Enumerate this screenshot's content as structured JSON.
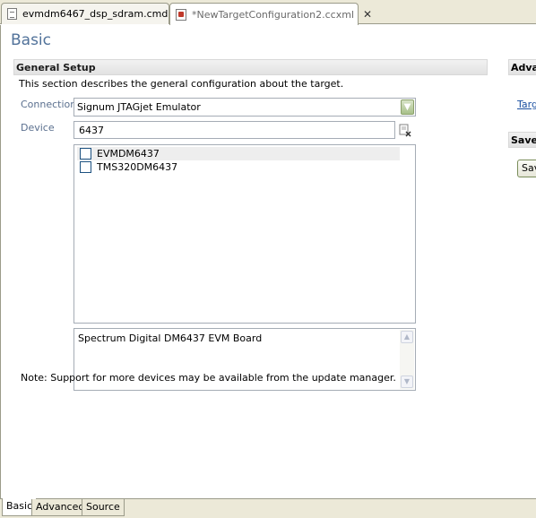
{
  "editor_tabs": [
    {
      "label": "evmdm6467_dsp_sdram.cmd",
      "icon": "file-icon",
      "active": false
    },
    {
      "label": "*NewTargetConfiguration2.ccxml",
      "icon": "target-config-icon",
      "active": true,
      "close": "close-icon"
    }
  ],
  "page_title": "Basic",
  "general_setup": {
    "title": "General Setup",
    "description": "This section describes the general configuration about the target.",
    "connection_label": "Connection",
    "connection_value": "Signum JTAGjet Emulator",
    "device_label": "Device",
    "device_filter": "6437",
    "devices": [
      {
        "label": "EVMDM6437",
        "checked": false,
        "selected": true
      },
      {
        "label": "TMS320DM6437",
        "checked": false,
        "selected": false
      }
    ],
    "device_description": "Spectrum Digital DM6437 EVM Board",
    "note": "Note: Support for more devices may be available from the update manager."
  },
  "advanced_section": {
    "title": "Adva",
    "link": "Targ"
  },
  "save_section": {
    "title": "Save",
    "button": "Sav"
  },
  "bottom_tabs": [
    {
      "label": "Basic",
      "active": true
    },
    {
      "label": "Advanced",
      "active": false
    },
    {
      "label": "Source",
      "active": false
    }
  ],
  "colors": {
    "title": "#51729a",
    "label": "#5a6f8e",
    "link": "#1a4fa0"
  }
}
